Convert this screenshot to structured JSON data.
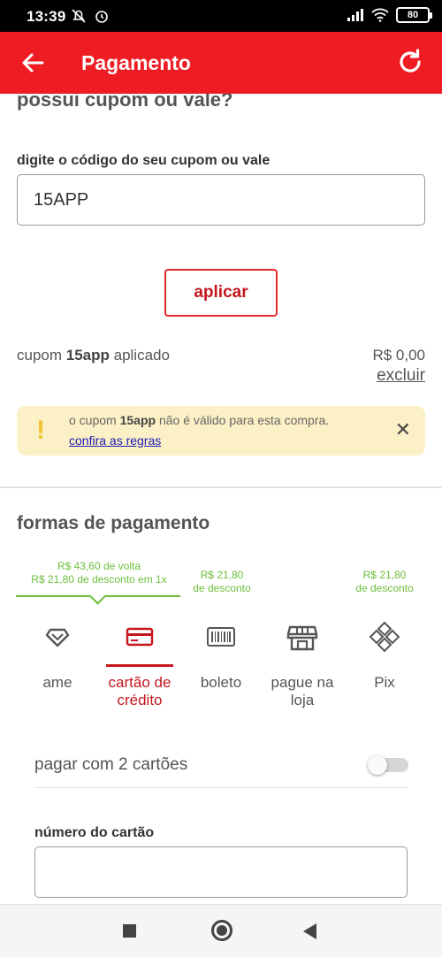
{
  "status_bar": {
    "time": "13:39",
    "battery": "80"
  },
  "app_bar": {
    "title": "Pagamento"
  },
  "coupon": {
    "heading": "possui cupom ou vale?",
    "field_label": "digite o código do seu cupom ou vale",
    "input_value": "15APP",
    "apply_label": "aplicar",
    "applied_prefix": "cupom ",
    "applied_code": "15app",
    "applied_suffix": " aplicado",
    "applied_value": "R$ 0,00",
    "remove_label": "excluir"
  },
  "alert": {
    "text_prefix": "o cupom ",
    "code": "15app",
    "text_suffix": " não é válido para esta compra.",
    "link": "confira as regras"
  },
  "payment": {
    "heading": "formas de pagamento",
    "promos": {
      "ame_line1": "R$ 43,60  de volta",
      "ame_line2": "R$ 21,80 de desconto em 1x",
      "boleto_line1": "R$ 21,80",
      "boleto_line2": "de desconto",
      "pix_line1": "R$ 21,80",
      "pix_line2": "de desconto"
    },
    "methods": [
      {
        "label": "ame",
        "icon": "ame-heart-icon"
      },
      {
        "label": "cartão de crédito",
        "icon": "credit-card-icon",
        "active": true
      },
      {
        "label": "boleto",
        "icon": "barcode-icon"
      },
      {
        "label": "pague na loja",
        "icon": "store-icon"
      },
      {
        "label": "Pix",
        "icon": "pix-icon"
      }
    ],
    "two_cards_label": "pagar com 2 cartões",
    "card_number_label": "número do cartão",
    "card_number_value": ""
  },
  "colors": {
    "brand": "#ee1d23",
    "accent": "#c4161c",
    "promo": "#6cbf3a",
    "alert_bg": "#fbf0c6"
  }
}
